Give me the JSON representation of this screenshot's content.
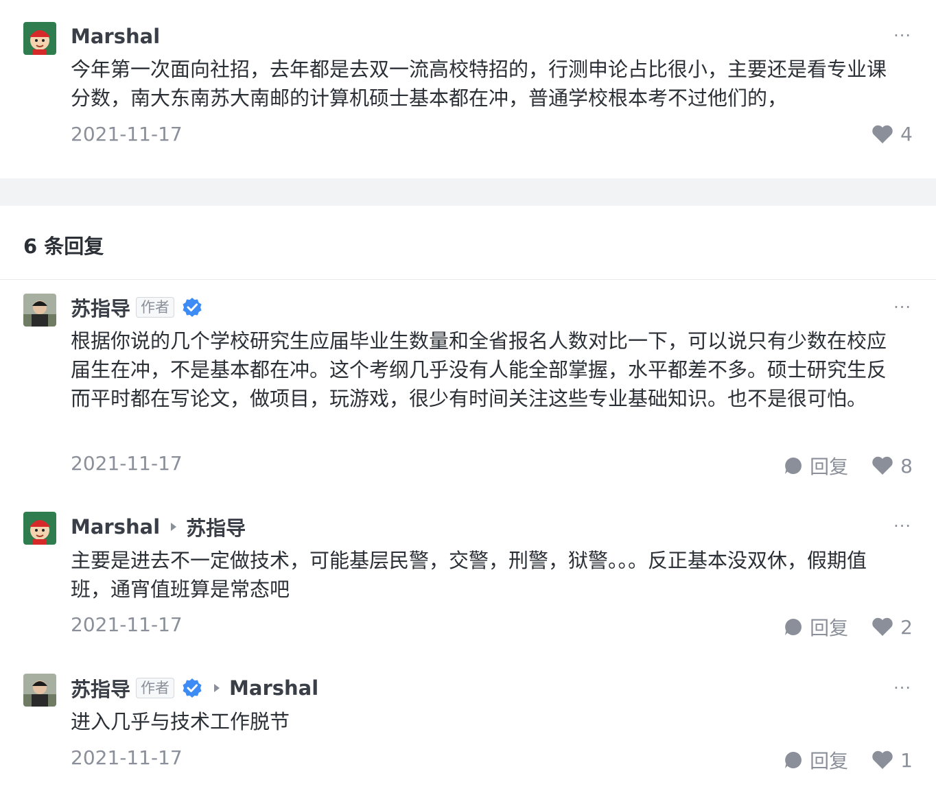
{
  "main_comment": {
    "author": "Marshal",
    "text": "今年第一次面向社招，去年都是去双一流高校特招的，行测申论占比很小，主要还是看专业课分数，南大东南苏大南邮的计算机硕士基本都在冲，普通学校根本考不过他们的，",
    "date": "2021-11-17",
    "likes": "4"
  },
  "replies_header": "6 条回复",
  "replies": [
    {
      "author": "苏指导",
      "tag": "作者",
      "text": "根据你说的几个学校研究生应届毕业生数量和全省报名人数对比一下，可以说只有少数在校应届生在冲，不是基本都在冲。这个考纲几乎没有人能全部掌握，水平都差不多。硕士研究生反而平时都在写论文，做项目，玩游戏，很少有时间关注这些专业基础知识。也不是很可怕。",
      "date": "2021-11-17",
      "reply_label": "回复",
      "likes": "8"
    },
    {
      "author": "Marshal",
      "reply_to": "苏指导",
      "text": "主要是进去不一定做技术，可能基层民警，交警，刑警，狱警。。。反正基本没双休，假期值班，通宵值班算是常态吧",
      "date": "2021-11-17",
      "reply_label": "回复",
      "likes": "2"
    },
    {
      "author": "苏指导",
      "tag": "作者",
      "reply_to": "Marshal",
      "text": "进入几乎与技术工作脱节",
      "date": "2021-11-17",
      "reply_label": "回复",
      "likes": "1"
    }
  ],
  "more_symbol": "···",
  "icons": {
    "more": "more-dots-icon",
    "like": "heart-icon",
    "reply": "comment-bubble-icon",
    "verified": "verified-badge-icon"
  },
  "colors": {
    "verified": "#3d8cf5",
    "muted": "#8a8f99",
    "band": "#f2f3f5"
  }
}
